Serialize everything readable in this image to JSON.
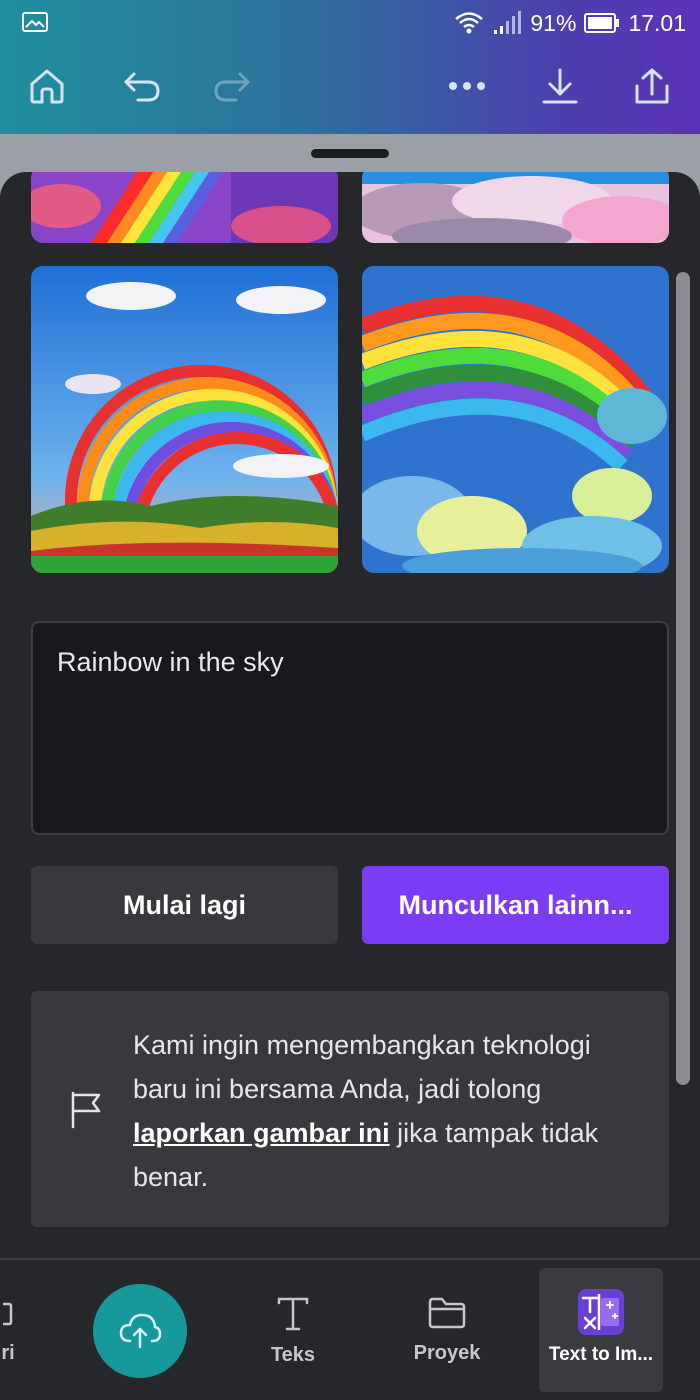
{
  "status_bar": {
    "battery": "91%",
    "time": "17.01"
  },
  "toolbar": {
    "home": "home-icon",
    "undo": "undo-icon",
    "redo": "redo-icon",
    "more": "more-icon",
    "download": "download-icon",
    "share": "share-icon"
  },
  "prompt": {
    "value": "Rainbow in the sky"
  },
  "actions": {
    "reset_label": "Mulai lagi",
    "generate_label": "Munculkan lainn..."
  },
  "report": {
    "text_before": "Kami ingin mengembangkan teknologi baru ini bersama Anda, jadi tolong ",
    "link": "laporkan gambar ini",
    "text_after": " jika tampak tidak benar."
  },
  "bottom_nav": {
    "partial_label": "ri",
    "text_label": "Teks",
    "projects_label": "Proyek",
    "app_label": "Text to Im..."
  },
  "colors": {
    "accent": "#7b3cf6",
    "upload": "#17999b",
    "panel": "#26272b"
  }
}
